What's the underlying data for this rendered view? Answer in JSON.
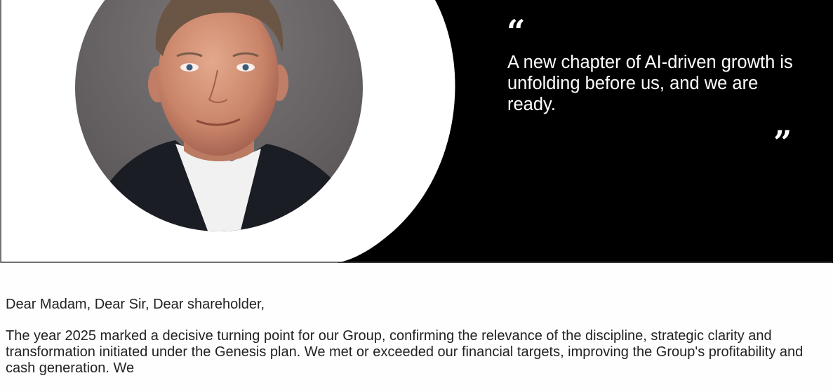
{
  "quote": {
    "open_mark": "“",
    "text": "A new chapter of AI-driven growth is unfolding before us, and we are ready.",
    "close_mark": "”"
  },
  "letter": {
    "salutation": "Dear Madam, Dear Sir, Dear shareholder,",
    "paragraph_1": "The year 2025 marked a decisive turning point for our Group, confirming the relevance of the discipline, strategic clarity and transformation initiated under the Genesis plan. We met or exceeded our financial targets, improving the Group's profitability and cash generation. We"
  },
  "colors": {
    "banner_background": "#000000",
    "photo_backdrop": "#6e6a6b",
    "text_on_banner": "#ffffff"
  }
}
